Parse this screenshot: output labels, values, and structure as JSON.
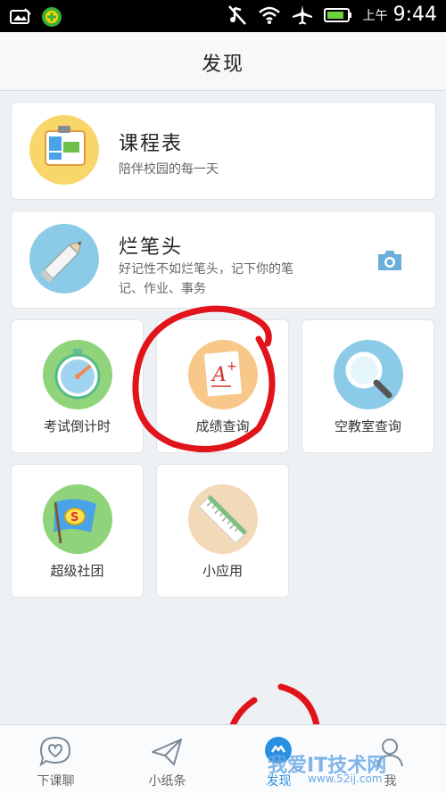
{
  "status_bar": {
    "ampm": "上午",
    "time": "9:44"
  },
  "header": {
    "title": "发现"
  },
  "featured": [
    {
      "title": "课程表",
      "subtitle": "陪伴校园的每一天",
      "icon": "timetable-icon"
    },
    {
      "title": "烂笔头",
      "subtitle_line1": "好记性不如烂笔头，记下你的笔",
      "subtitle_line2": "记、作业、事务",
      "icon": "pencil-icon",
      "action_icon": "camera-icon"
    }
  ],
  "tiles": [
    {
      "label": "考试倒计时",
      "icon": "stopwatch-icon",
      "color": "#8fd47a"
    },
    {
      "label": "成绩查询",
      "icon": "grade-paper-icon",
      "color": "#f7c88a"
    },
    {
      "label": "空教室查询",
      "icon": "magnifier-icon",
      "color": "#8ccbe8"
    },
    {
      "label": "超级社团",
      "icon": "club-flag-icon",
      "color": "#8fd47a"
    },
    {
      "label": "小应用",
      "icon": "ruler-icon",
      "color": "#f2d9b8"
    }
  ],
  "bottom_nav": [
    {
      "label": "下课聊",
      "icon": "chat-heart-icon",
      "active": false
    },
    {
      "label": "小纸条",
      "icon": "paper-plane-icon",
      "active": false
    },
    {
      "label": "发现",
      "icon": "discover-icon",
      "active": true
    },
    {
      "label": "我",
      "icon": "profile-icon",
      "active": false
    }
  ],
  "watermark": {
    "text": "我爱IT技术网",
    "url": "www.52ij.com"
  },
  "colors": {
    "accent": "#2b8fe0",
    "annotation": "#e0141a"
  }
}
